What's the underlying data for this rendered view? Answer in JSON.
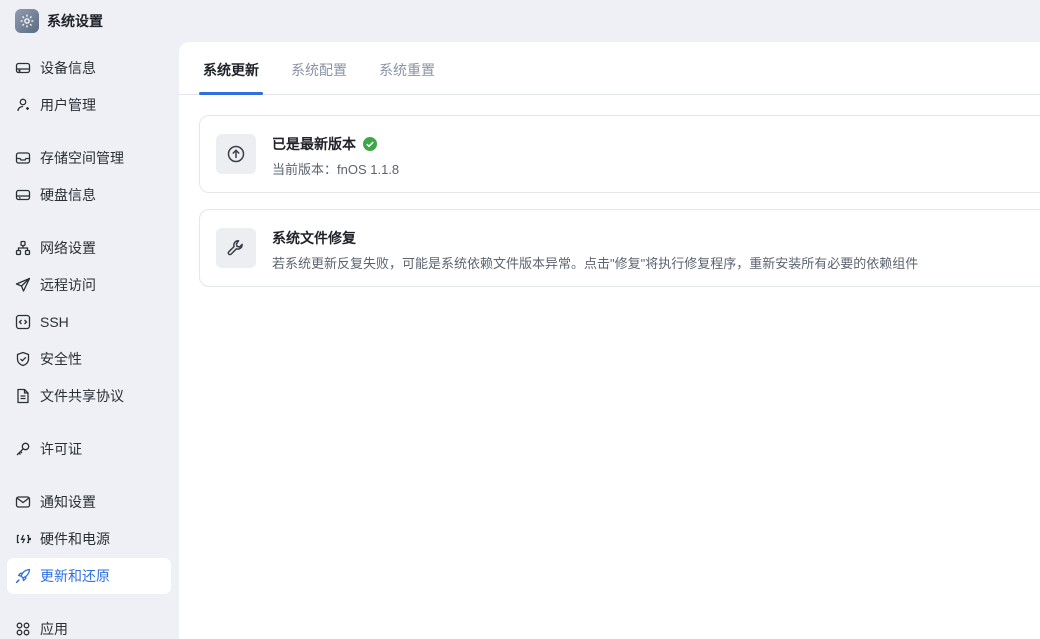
{
  "app": {
    "title": "系统设置"
  },
  "sidebar": {
    "items": [
      {
        "label": "设备信息",
        "icon": "device-icon"
      },
      {
        "label": "用户管理",
        "icon": "user-icon"
      },
      {
        "label": "存储空间管理",
        "icon": "storage-icon"
      },
      {
        "label": "硬盘信息",
        "icon": "disk-icon"
      },
      {
        "label": "网络设置",
        "icon": "network-icon"
      },
      {
        "label": "远程访问",
        "icon": "send-icon"
      },
      {
        "label": "SSH",
        "icon": "code-icon"
      },
      {
        "label": "安全性",
        "icon": "shield-icon"
      },
      {
        "label": "文件共享协议",
        "icon": "file-icon"
      },
      {
        "label": "许可证",
        "icon": "key-icon"
      },
      {
        "label": "通知设置",
        "icon": "mail-icon"
      },
      {
        "label": "硬件和电源",
        "icon": "power-icon"
      },
      {
        "label": "更新和还原",
        "icon": "rocket-icon",
        "active": true
      },
      {
        "label": "应用",
        "icon": "apps-icon"
      }
    ]
  },
  "tabs": [
    {
      "label": "系统更新",
      "active": true
    },
    {
      "label": "系统配置"
    },
    {
      "label": "系统重置"
    }
  ],
  "cards": {
    "update": {
      "title": "已是最新版本",
      "desc": "当前版本：fnOS 1.1.8",
      "icon": "arrow-up-circle-icon",
      "status_icon": "check-circle-icon"
    },
    "repair": {
      "title": "系统文件修复",
      "desc": "若系统更新反复失败，可能是系统依赖文件版本异常。点击\"修复\"将执行修复程序，重新安装所有必要的依赖组件",
      "icon": "wrench-icon"
    }
  },
  "colors": {
    "accent": "#2f6fe0",
    "success": "#3fa64a",
    "sidebar_bg": "#eef0f5"
  }
}
